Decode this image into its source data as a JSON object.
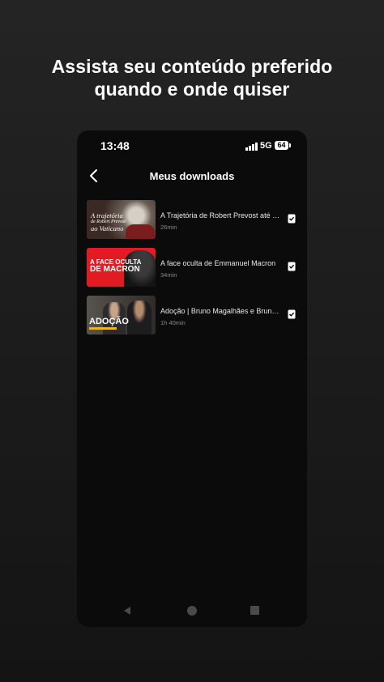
{
  "headline": {
    "line1": "Assista seu conteúdo preferido",
    "line2": "quando e onde quiser"
  },
  "status_bar": {
    "time": "13:48",
    "network": "5G",
    "battery": "64"
  },
  "app_bar": {
    "title": "Meus downloads",
    "back_icon": "chevron-left-icon"
  },
  "downloads": [
    {
      "title": "A Trajetória de Robert Prevost até o Vaticano",
      "duration": "26min",
      "thumb_text": [
        "A trajetória",
        "de Robert Prevost",
        "ao Vaticano"
      ]
    },
    {
      "title": "A face oculta de Emmanuel Macron",
      "duration": "34min",
      "thumb_text": [
        "A FACE OCULTA",
        "DE MACRON"
      ]
    },
    {
      "title": "Adoção | Bruno Magalhães e Bruno ...",
      "duration": "1h 40min",
      "thumb_text": [
        "ADOÇÃO"
      ]
    }
  ],
  "icons": {
    "downloaded": "downloaded-check-icon",
    "nav_back": "triangle-back-icon",
    "nav_home": "circle-home-icon",
    "nav_recents": "square-recents-icon"
  },
  "colors": {
    "background": "#1e1e1e",
    "phone": "#0b0b0b",
    "accent_red": "#e21a22"
  }
}
